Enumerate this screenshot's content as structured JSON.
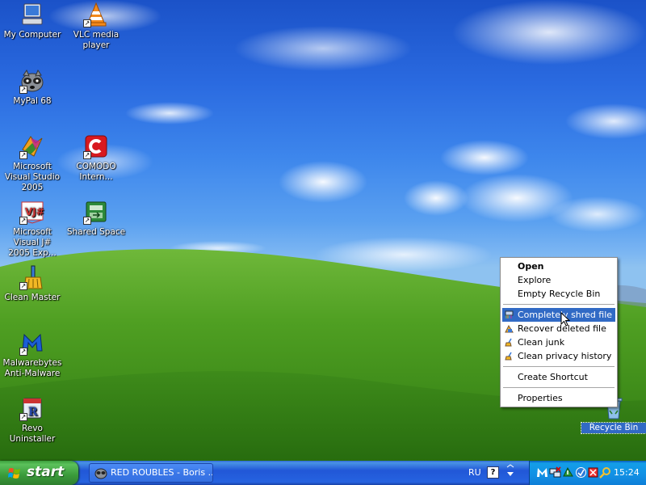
{
  "desktop": {
    "icons": [
      {
        "label": "My Computer",
        "icon": "my-computer-icon"
      },
      {
        "label": "VLC media player",
        "icon": "vlc-cone-icon"
      },
      {
        "label": "MyPal 68",
        "icon": "mypal-raccoon-icon"
      },
      {
        "label": "Microsoft Visual Studio 2005",
        "icon": "visual-studio-icon"
      },
      {
        "label": "COMODO Intern...",
        "icon": "comodo-icon"
      },
      {
        "label": "Microsoft Visual J# 2005 Exp...",
        "icon": "visual-j-sharp-icon"
      },
      {
        "label": "Shared Space",
        "icon": "shared-space-icon"
      },
      {
        "label": "Clean Master",
        "icon": "clean-master-broom-icon"
      },
      {
        "label": "Malwarebytes Anti-Malware",
        "icon": "malwarebytes-icon"
      },
      {
        "label": "Revo Uninstaller",
        "icon": "revo-uninstaller-icon"
      },
      {
        "label": "Recycle Bin",
        "icon": "recycle-bin-icon"
      }
    ]
  },
  "context_menu": {
    "items": [
      {
        "label": "Open",
        "bold": true
      },
      {
        "label": "Explore"
      },
      {
        "label": "Empty Recycle Bin"
      },
      {
        "label": "Completely shred file",
        "highlighted": true,
        "icon": "shred-icon"
      },
      {
        "label": "Recover deleted file",
        "icon": "recover-icon"
      },
      {
        "label": "Clean junk",
        "icon": "broom-icon"
      },
      {
        "label": "Clean privacy history",
        "icon": "broom-icon"
      },
      {
        "label": "Create Shortcut"
      },
      {
        "label": "Properties"
      }
    ]
  },
  "taskbar": {
    "start_label": "start",
    "task_label": "RED ROUBLES - Boris ...",
    "language": "RU",
    "help_glyph": "?",
    "clock": "15:24",
    "tray_icons": [
      "malwarebytes-tray-icon",
      "network-tray-icon",
      "comodo-tray-icon",
      "update-tray-icon",
      "security-tray-icon",
      "search-tray-icon"
    ]
  },
  "colors": {
    "selection": "#316ac5",
    "taskbar_blue": "#2157d7",
    "start_green": "#3a9a3a",
    "tray_blue": "#1290e4"
  }
}
